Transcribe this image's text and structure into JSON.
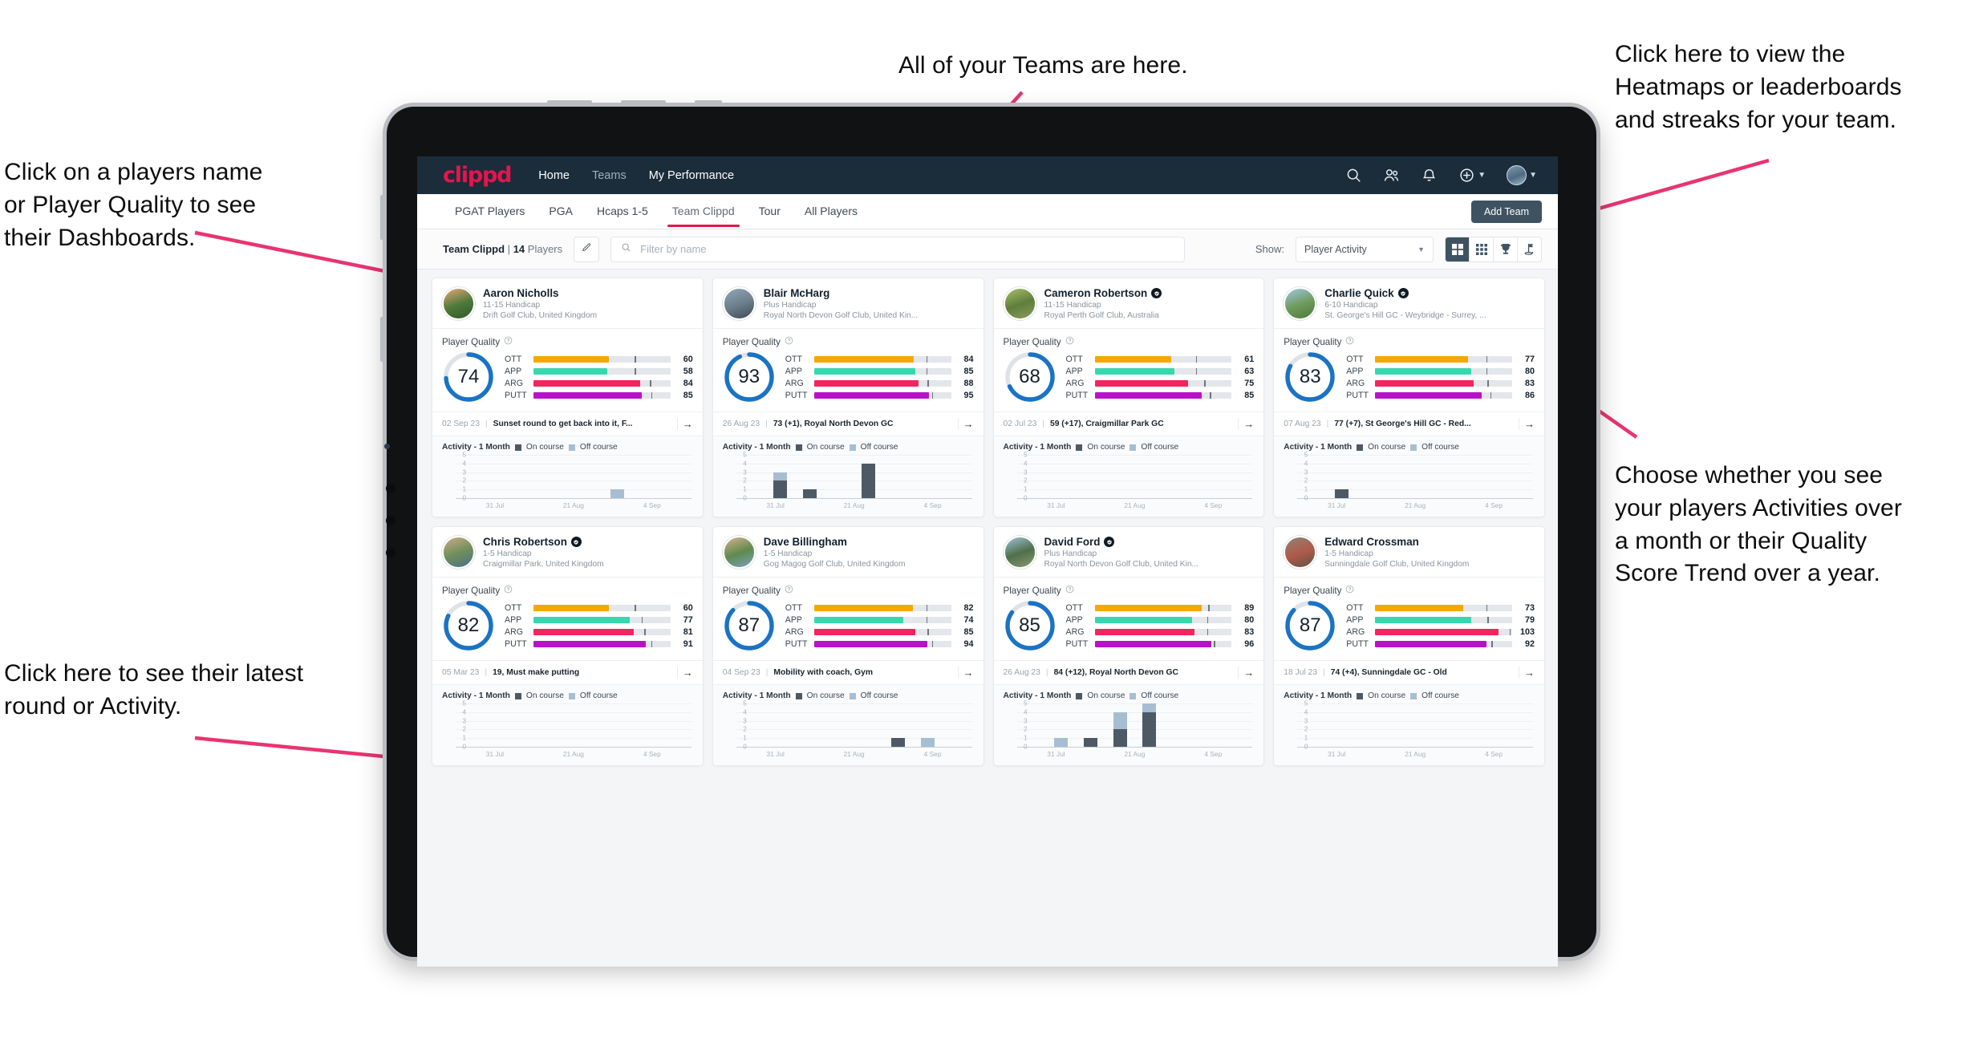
{
  "annotations": [
    {
      "id": "a-teams",
      "text": "All of your Teams are here."
    },
    {
      "id": "a-heatmaps",
      "text": "Click here to view the\nHeatmaps or leaderboards\nand streaks for your team."
    },
    {
      "id": "a-names",
      "text": "Click on a players name\nor Player Quality to see\ntheir Dashboards."
    },
    {
      "id": "a-show",
      "text": "Choose whether you see\nyour players Activities over\na month or their Quality\nScore Trend over a year."
    },
    {
      "id": "a-latest",
      "text": "Click here to see their latest\nround or Activity."
    }
  ],
  "colors": {
    "accent_pink": "#e8134e",
    "navbar": "#1b2c3b",
    "ring_blue": "#1a73c4",
    "ott": "#f5a800",
    "app": "#3ad6ae",
    "arg": "#f4245e",
    "putt": "#b812c9",
    "on_course": "#4d5a66",
    "off_course": "#a7bed2"
  },
  "navbar": {
    "logo": "clippd",
    "links": [
      {
        "label": "Home",
        "active": true
      },
      {
        "label": "Teams",
        "active": false
      },
      {
        "label": "My Performance",
        "active": true
      }
    ],
    "icons": [
      "search-icon",
      "people-icon",
      "bell-icon",
      "plus-circle-icon",
      "avatar"
    ]
  },
  "tabs": [
    {
      "label": "PGAT Players",
      "active": false
    },
    {
      "label": "PGA",
      "active": false
    },
    {
      "label": "Hcaps 1-5",
      "active": false
    },
    {
      "label": "Team Clippd",
      "active": true
    },
    {
      "label": "Tour",
      "active": false
    },
    {
      "label": "All Players",
      "active": false
    }
  ],
  "add_team_label": "Add Team",
  "toolbar": {
    "team_name": "Team Clippd",
    "separator": "|",
    "player_count": "14",
    "players_word": "Players",
    "edit_icon": "pencil-icon",
    "search_placeholder": "Filter by name",
    "search_value": "",
    "show_label": "Show:",
    "show_value": "Player Activity",
    "show_options": [
      "Player Activity",
      "Quality Score Trend"
    ],
    "view_buttons": [
      {
        "name": "grid-large-icon",
        "active": true
      },
      {
        "name": "grid-small-icon",
        "active": false
      },
      {
        "name": "trophy-icon",
        "active": false
      },
      {
        "name": "flag-pin-icon",
        "active": false
      }
    ]
  },
  "card_labels": {
    "player_quality": "Player Quality",
    "help_icon": "help-circle-icon",
    "activity": "Activity - 1 Month",
    "legend_on": "On course",
    "legend_off": "Off course",
    "arrow_icon": "arrow-right-icon"
  },
  "chart_data": {
    "type": "bar",
    "title": "Activity - 1 Month",
    "xlabel": "",
    "ylabel": "",
    "ylim": [
      0,
      5
    ],
    "yticks": [
      5,
      4,
      3,
      2,
      1,
      0
    ],
    "xticks": [
      "31 Jul",
      "21 Aug",
      "4 Sep"
    ],
    "grid": true,
    "legend": [
      "On course",
      "Off course"
    ],
    "legend_position": "top",
    "bins": 8
  },
  "players": [
    {
      "name": "Aaron Nicholls",
      "verified": false,
      "handicap": "11-15 Handicap",
      "club": "Drift Golf Club, United Kingdom",
      "avatar_colors": [
        "#e8a877",
        "#4f7a3a",
        "#2e5a28"
      ],
      "quality": 74,
      "metrics": [
        {
          "label": "OTT",
          "value": 60,
          "color": "#f5a800",
          "fill_pct": 55,
          "tick_pct": 74
        },
        {
          "label": "APP",
          "value": 58,
          "color": "#3ad6ae",
          "fill_pct": 54,
          "tick_pct": 74
        },
        {
          "label": "ARG",
          "value": 84,
          "color": "#f4245e",
          "fill_pct": 78,
          "tick_pct": 85
        },
        {
          "label": "PUTT",
          "value": 85,
          "color": "#b812c9",
          "fill_pct": 79,
          "tick_pct": 86
        }
      ],
      "latest": {
        "date": "02 Sep 23",
        "text": "Sunset round to get back into it, F..."
      },
      "activity": [
        {
          "on": 0,
          "off": 0
        },
        {
          "on": 0,
          "off": 0
        },
        {
          "on": 0,
          "off": 0
        },
        {
          "on": 0,
          "off": 0
        },
        {
          "on": 0,
          "off": 0
        },
        {
          "on": 0,
          "off": 1
        },
        {
          "on": 0,
          "off": 0
        },
        {
          "on": 0,
          "off": 0
        }
      ]
    },
    {
      "name": "Blair McHarg",
      "verified": false,
      "handicap": "Plus Handicap",
      "club": "Royal North Devon Golf Club, United Kin...",
      "avatar_colors": [
        "#8fa6b8",
        "#6d7f8c",
        "#3c4a54"
      ],
      "quality": 93,
      "metrics": [
        {
          "label": "OTT",
          "value": 84,
          "color": "#f5a800",
          "fill_pct": 73,
          "tick_pct": 82
        },
        {
          "label": "APP",
          "value": 85,
          "color": "#3ad6ae",
          "fill_pct": 74,
          "tick_pct": 82
        },
        {
          "label": "ARG",
          "value": 88,
          "color": "#f4245e",
          "fill_pct": 76,
          "tick_pct": 83
        },
        {
          "label": "PUTT",
          "value": 95,
          "color": "#b812c9",
          "fill_pct": 84,
          "tick_pct": 86
        }
      ],
      "latest": {
        "date": "26 Aug 23",
        "text": "73 (+1), Royal North Devon GC"
      },
      "activity": [
        {
          "on": 0,
          "off": 0
        },
        {
          "on": 2,
          "off": 1
        },
        {
          "on": 1,
          "off": 0
        },
        {
          "on": 0,
          "off": 0
        },
        {
          "on": 4,
          "off": 0
        },
        {
          "on": 0,
          "off": 0
        },
        {
          "on": 0,
          "off": 0
        },
        {
          "on": 0,
          "off": 0
        }
      ]
    },
    {
      "name": "Cameron Robertson",
      "verified": true,
      "handicap": "11-15 Handicap",
      "club": "Royal Perth Golf Club, Australia",
      "avatar_colors": [
        "#a8c06a",
        "#5f7e3c",
        "#8c9c5a"
      ],
      "quality": 68,
      "metrics": [
        {
          "label": "OTT",
          "value": 61,
          "color": "#f5a800",
          "fill_pct": 56,
          "tick_pct": 74
        },
        {
          "label": "APP",
          "value": 63,
          "color": "#3ad6ae",
          "fill_pct": 58,
          "tick_pct": 74
        },
        {
          "label": "ARG",
          "value": 75,
          "color": "#f4245e",
          "fill_pct": 68,
          "tick_pct": 80
        },
        {
          "label": "PUTT",
          "value": 85,
          "color": "#b812c9",
          "fill_pct": 78,
          "tick_pct": 84
        }
      ],
      "latest": {
        "date": "02 Jul 23",
        "text": "59 (+17), Craigmillar Park GC"
      },
      "activity": [
        {
          "on": 0,
          "off": 0
        },
        {
          "on": 0,
          "off": 0
        },
        {
          "on": 0,
          "off": 0
        },
        {
          "on": 0,
          "off": 0
        },
        {
          "on": 0,
          "off": 0
        },
        {
          "on": 0,
          "off": 0
        },
        {
          "on": 0,
          "off": 0
        },
        {
          "on": 0,
          "off": 0
        }
      ]
    },
    {
      "name": "Charlie Quick",
      "verified": true,
      "handicap": "6-10 Handicap",
      "club": "St. George's Hill GC - Weybridge - Surrey, ...",
      "avatar_colors": [
        "#9fc8e3",
        "#6f9b5c",
        "#4d7a3f"
      ],
      "quality": 83,
      "metrics": [
        {
          "label": "OTT",
          "value": 77,
          "color": "#f5a800",
          "fill_pct": 68,
          "tick_pct": 81
        },
        {
          "label": "APP",
          "value": 80,
          "color": "#3ad6ae",
          "fill_pct": 70,
          "tick_pct": 81
        },
        {
          "label": "ARG",
          "value": 83,
          "color": "#f4245e",
          "fill_pct": 72,
          "tick_pct": 82
        },
        {
          "label": "PUTT",
          "value": 86,
          "color": "#b812c9",
          "fill_pct": 78,
          "tick_pct": 84
        }
      ],
      "latest": {
        "date": "07 Aug 23",
        "text": "77 (+7), St George's Hill GC - Red..."
      },
      "activity": [
        {
          "on": 0,
          "off": 0
        },
        {
          "on": 1,
          "off": 0
        },
        {
          "on": 0,
          "off": 0
        },
        {
          "on": 0,
          "off": 0
        },
        {
          "on": 0,
          "off": 0
        },
        {
          "on": 0,
          "off": 0
        },
        {
          "on": 0,
          "off": 0
        },
        {
          "on": 0,
          "off": 0
        }
      ]
    },
    {
      "name": "Chris Robertson",
      "verified": true,
      "handicap": "1-5 Handicap",
      "club": "Craigmillar Park, United Kingdom",
      "avatar_colors": [
        "#cfa98a",
        "#6d8f5a",
        "#4e6f8c"
      ],
      "quality": 82,
      "metrics": [
        {
          "label": "OTT",
          "value": 60,
          "color": "#f5a800",
          "fill_pct": 55,
          "tick_pct": 74
        },
        {
          "label": "APP",
          "value": 77,
          "color": "#3ad6ae",
          "fill_pct": 70,
          "tick_pct": 79
        },
        {
          "label": "ARG",
          "value": 81,
          "color": "#f4245e",
          "fill_pct": 73,
          "tick_pct": 81
        },
        {
          "label": "PUTT",
          "value": 91,
          "color": "#b812c9",
          "fill_pct": 82,
          "tick_pct": 86
        }
      ],
      "latest": {
        "date": "05 Mar 23",
        "text": "19, Must make putting"
      },
      "activity": [
        {
          "on": 0,
          "off": 0
        },
        {
          "on": 0,
          "off": 0
        },
        {
          "on": 0,
          "off": 0
        },
        {
          "on": 0,
          "off": 0
        },
        {
          "on": 0,
          "off": 0
        },
        {
          "on": 0,
          "off": 0
        },
        {
          "on": 0,
          "off": 0
        },
        {
          "on": 0,
          "off": 0
        }
      ]
    },
    {
      "name": "Dave Billingham",
      "verified": false,
      "handicap": "1-5 Handicap",
      "club": "Gog Magog Golf Club, United Kingdom",
      "avatar_colors": [
        "#d7b18f",
        "#5f8a4e",
        "#7da0bd"
      ],
      "quality": 87,
      "metrics": [
        {
          "label": "OTT",
          "value": 82,
          "color": "#f5a800",
          "fill_pct": 72,
          "tick_pct": 82
        },
        {
          "label": "APP",
          "value": 74,
          "color": "#3ad6ae",
          "fill_pct": 65,
          "tick_pct": 82
        },
        {
          "label": "ARG",
          "value": 85,
          "color": "#f4245e",
          "fill_pct": 74,
          "tick_pct": 83
        },
        {
          "label": "PUTT",
          "value": 94,
          "color": "#b812c9",
          "fill_pct": 83,
          "tick_pct": 86
        }
      ],
      "latest": {
        "date": "04 Sep 23",
        "text": "Mobility with coach, Gym"
      },
      "activity": [
        {
          "on": 0,
          "off": 0
        },
        {
          "on": 0,
          "off": 0
        },
        {
          "on": 0,
          "off": 0
        },
        {
          "on": 0,
          "off": 0
        },
        {
          "on": 0,
          "off": 0
        },
        {
          "on": 1,
          "off": 0
        },
        {
          "on": 0,
          "off": 1
        },
        {
          "on": 0,
          "off": 0
        }
      ]
    },
    {
      "name": "David Ford",
      "verified": true,
      "handicap": "Plus Handicap",
      "club": "Royal North Devon Golf Club, United Kin...",
      "avatar_colors": [
        "#9fc2d8",
        "#4f6f4a",
        "#8a9a72"
      ],
      "quality": 85,
      "metrics": [
        {
          "label": "OTT",
          "value": 89,
          "color": "#f5a800",
          "fill_pct": 78,
          "tick_pct": 83
        },
        {
          "label": "APP",
          "value": 80,
          "color": "#3ad6ae",
          "fill_pct": 71,
          "tick_pct": 82
        },
        {
          "label": "ARG",
          "value": 83,
          "color": "#f4245e",
          "fill_pct": 73,
          "tick_pct": 82
        },
        {
          "label": "PUTT",
          "value": 96,
          "color": "#b812c9",
          "fill_pct": 85,
          "tick_pct": 87
        }
      ],
      "latest": {
        "date": "26 Aug 23",
        "text": "84 (+12), Royal North Devon GC"
      },
      "activity": [
        {
          "on": 0,
          "off": 0
        },
        {
          "on": 0,
          "off": 1
        },
        {
          "on": 1,
          "off": 0
        },
        {
          "on": 2,
          "off": 2
        },
        {
          "on": 4,
          "off": 1
        },
        {
          "on": 0,
          "off": 0
        },
        {
          "on": 0,
          "off": 0
        },
        {
          "on": 0,
          "off": 0
        }
      ]
    },
    {
      "name": "Edward Crossman",
      "verified": false,
      "handicap": "1-5 Handicap",
      "club": "Sunningdale Golf Club, United Kingdom",
      "avatar_colors": [
        "#8f8375",
        "#b05a4a",
        "#5c5448"
      ],
      "quality": 87,
      "metrics": [
        {
          "label": "OTT",
          "value": 73,
          "color": "#f5a800",
          "fill_pct": 64,
          "tick_pct": 81
        },
        {
          "label": "APP",
          "value": 79,
          "color": "#3ad6ae",
          "fill_pct": 70,
          "tick_pct": 82
        },
        {
          "label": "ARG",
          "value": 103,
          "color": "#f4245e",
          "fill_pct": 90,
          "tick_pct": 98
        },
        {
          "label": "PUTT",
          "value": 92,
          "color": "#b812c9",
          "fill_pct": 81,
          "tick_pct": 85
        }
      ],
      "latest": {
        "date": "18 Jul 23",
        "text": "74 (+4), Sunningdale GC - Old"
      },
      "activity": [
        {
          "on": 0,
          "off": 0
        },
        {
          "on": 0,
          "off": 0
        },
        {
          "on": 0,
          "off": 0
        },
        {
          "on": 0,
          "off": 0
        },
        {
          "on": 0,
          "off": 0
        },
        {
          "on": 0,
          "off": 0
        },
        {
          "on": 0,
          "off": 0
        },
        {
          "on": 0,
          "off": 0
        }
      ]
    }
  ]
}
